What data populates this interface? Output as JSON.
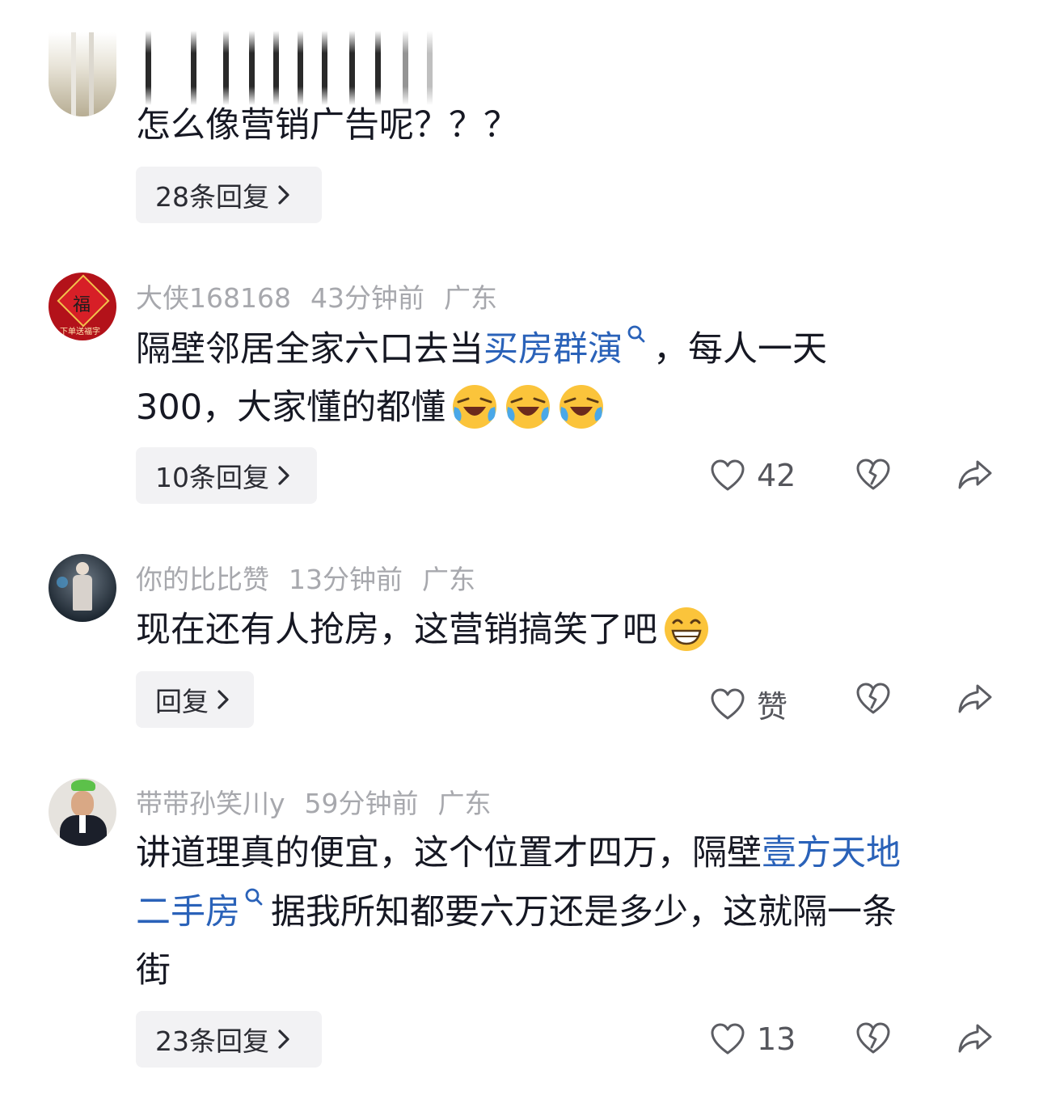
{
  "comments": [
    {
      "text": "怎么像营销广告呢？？？",
      "reply_label": "28条回复"
    },
    {
      "username": "大侠168168",
      "time": "43分钟前",
      "location": "广东",
      "avatar_caption": "下单送福字",
      "text_line1_a": "隔壁邻居全家六口去当",
      "text_line1_link": "买房群演",
      "text_line1_b": "，每人一天",
      "text_line2": "300，大家懂的都懂",
      "emojis": [
        "laughing-crying-emoji",
        "laughing-crying-emoji",
        "laughing-crying-emoji"
      ],
      "reply_label": "10条回复",
      "likes": "42"
    },
    {
      "username": "你的比比赞",
      "time": "13分钟前",
      "location": "广东",
      "text": "现在还有人抢房，这营销搞笑了吧",
      "emoji": "grinning-emoji",
      "reply_label": "回复",
      "likes": "赞"
    },
    {
      "username": "带带孙笑川y",
      "time": "59分钟前",
      "location": "广东",
      "text_line1_a": "讲道理真的便宜，这个位置才四万，隔壁",
      "text_line1_link": "壹方天地",
      "text_line2_link": "二手房",
      "text_line2_b": "据我所知都要六万还是多少，这就隔一条",
      "text_line3": "街",
      "reply_label": "23条回复",
      "likes": "13"
    }
  ],
  "colors": {
    "link": "#2a62b9",
    "meta": "#a7a8ad",
    "text": "#161823",
    "reply_bg": "#f2f2f4"
  },
  "icons": [
    "heart-icon",
    "dislike-icon",
    "share-icon",
    "search-icon",
    "chevron-right-icon"
  ]
}
